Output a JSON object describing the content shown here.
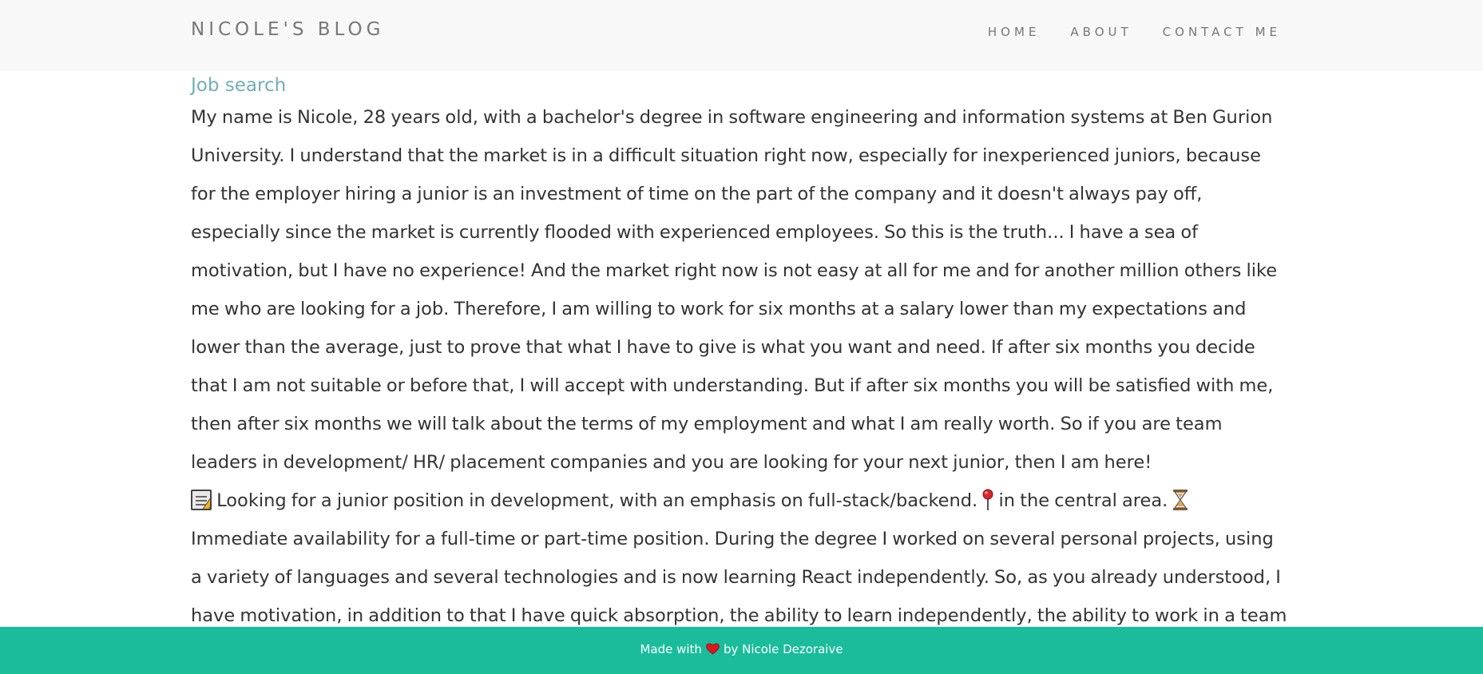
{
  "navbar": {
    "brand": "NICOLE'S BLOG",
    "links": [
      "HOME",
      "ABOUT",
      "CONTACT ME"
    ]
  },
  "post": {
    "title": "Job search",
    "body_part1": "My name is Nicole, 28 years old, with a bachelor's degree in software engineering and information systems at Ben Gurion University. I understand that the market is in a difficult situation right now, especially for inexperienced juniors, because for the employer hiring a junior is an investment of time on the part of the company and it doesn't always pay off, especially since the market is currently flooded with experienced employees. So this is the truth... I have a sea of motivation, but I have no experience! And the market right now is not easy at all for me and for another million others like me who are looking for a job. Therefore, I am willing to work for six months at a salary lower than my expectations and lower than the average, just to prove that what I have to give is what you want and need. If after six months you decide that I am not suitable or before that, I will accept with understanding. But if after six months you will be satisfied with me, then after six months we will talk about the terms of my employment and what I am really worth. So if you are team leaders in development/ HR/ placement companies and you are looking for your next junior, then I am here!",
    "body_part2": " Looking for a junior position in development, with an emphasis on full-stack/backend. ",
    "body_part3": " in the central area. ",
    "body_part4": " Immediate availability for a full-time or part-time position. During the degree I worked on several personal projects, using a variety of languages and several technologies and is now learning React independently. So, as you already understood, I have motivation, in addition to that I have quick absorption, the ability to learn independently, the ability to work in a team and I am ready to give everything to prove myself.",
    "icons": [
      "memo-icon",
      "round-pushpin-icon",
      "hourglass-icon"
    ]
  },
  "footer": {
    "prefix": "Made with",
    "suffix": "by Nicole Dezoraive",
    "icon": "heart-icon",
    "background": "#1abc9c"
  },
  "colors": {
    "navbar_bg": "#f8f8f8",
    "nav_text": "#777777",
    "title": "#72aeb8",
    "body_text": "#333333",
    "footer_bg": "#1abc9c"
  }
}
